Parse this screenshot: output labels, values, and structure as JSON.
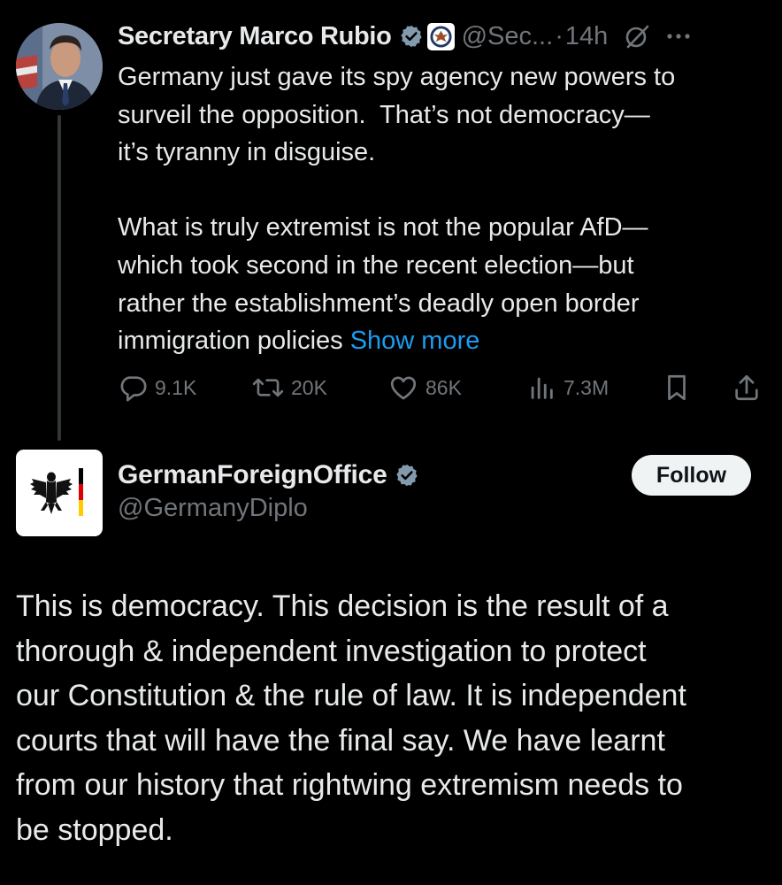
{
  "parent_tweet": {
    "display_name": "Secretary Marco Rubio",
    "handle": "@Sec...",
    "separator": "·",
    "time": "14h",
    "body": "Germany just gave its spy agency new powers to\nsurveil the opposition.  That’s not democracy—\nit’s tyranny in disguise.\n\nWhat is truly extremist is not the popular AfD—\nwhich took second in the recent election—but\nrather the establishment’s deadly open border\nimmigration policies ",
    "show_more": "Show more",
    "actions": {
      "replies": "9.1K",
      "reposts": "20K",
      "likes": "86K",
      "views": "7.3M"
    },
    "icons": {
      "verified": "verified-badge-icon",
      "affiliation": "state-department-seal-icon",
      "grok": "grok-icon",
      "more": "more-icon",
      "reply": "reply-icon",
      "repost": "repost-icon",
      "like": "heart-icon",
      "views": "views-icon",
      "bookmark": "bookmark-icon",
      "share": "share-icon"
    }
  },
  "reply_tweet": {
    "display_name": "GermanForeignOffice",
    "handle": "@GermanyDiplo",
    "follow_label": "Follow",
    "body": "This is democracy. This decision is the result of a\nthorough & independent investigation to protect\nour Constitution & the rule of law. It is independent\ncourts that will have the final say. We have learnt\nfrom our history that rightwing extremism needs to\nbe stopped."
  },
  "colors": {
    "background": "#000000",
    "text": "#e7e9ea",
    "secondary": "#71767b",
    "link": "#1d9bf0",
    "follow_bg": "#eff3f4"
  }
}
